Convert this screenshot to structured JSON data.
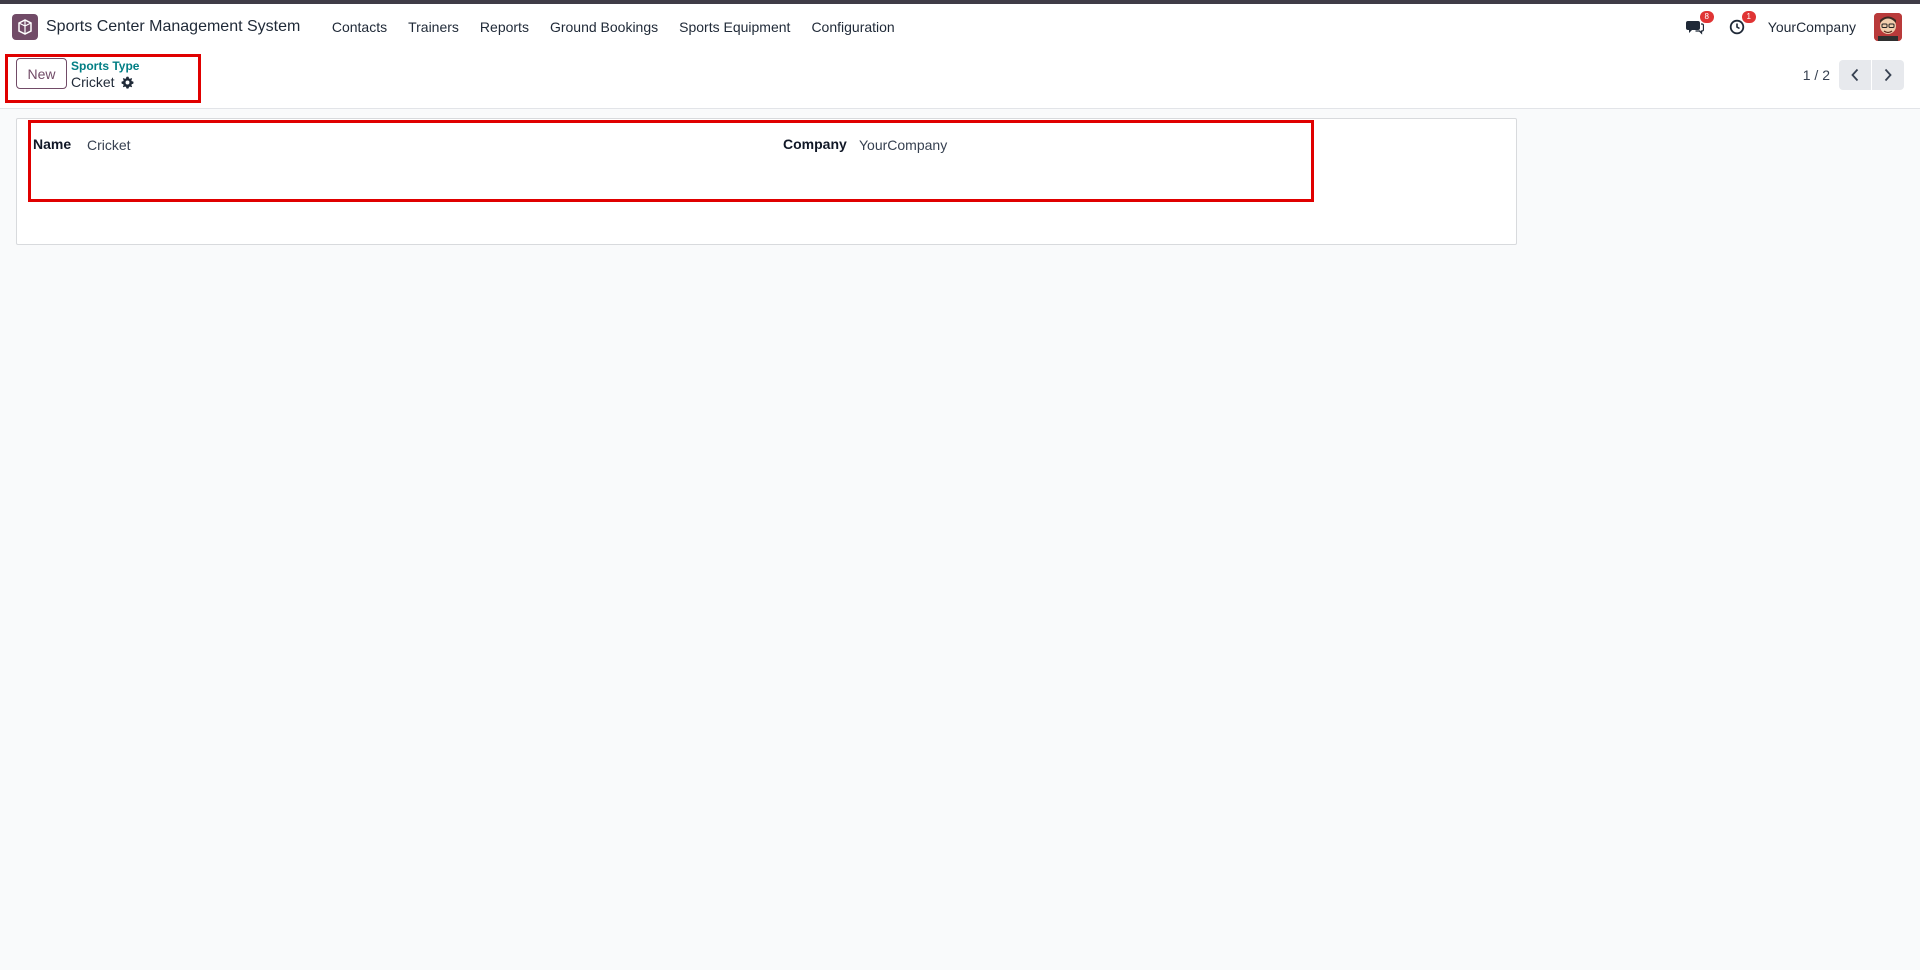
{
  "navbar": {
    "app_title": "Sports Center Management System",
    "menu": [
      "Contacts",
      "Trainers",
      "Reports",
      "Ground Bookings",
      "Sports Equipment",
      "Configuration"
    ],
    "messages_count": "8",
    "activities_count": "1",
    "company": "YourCompany"
  },
  "control_panel": {
    "new_label": "New",
    "breadcrumb_parent": "Sports Type",
    "breadcrumb_current": "Cricket",
    "pager": "1 / 2"
  },
  "form": {
    "name_label": "Name",
    "name_value": "Cricket",
    "company_label": "Company",
    "company_value": "YourCompany"
  },
  "colors": {
    "brand": "#714b67",
    "link": "#017e84",
    "highlight": "#e00000",
    "badge": "#e03434"
  }
}
